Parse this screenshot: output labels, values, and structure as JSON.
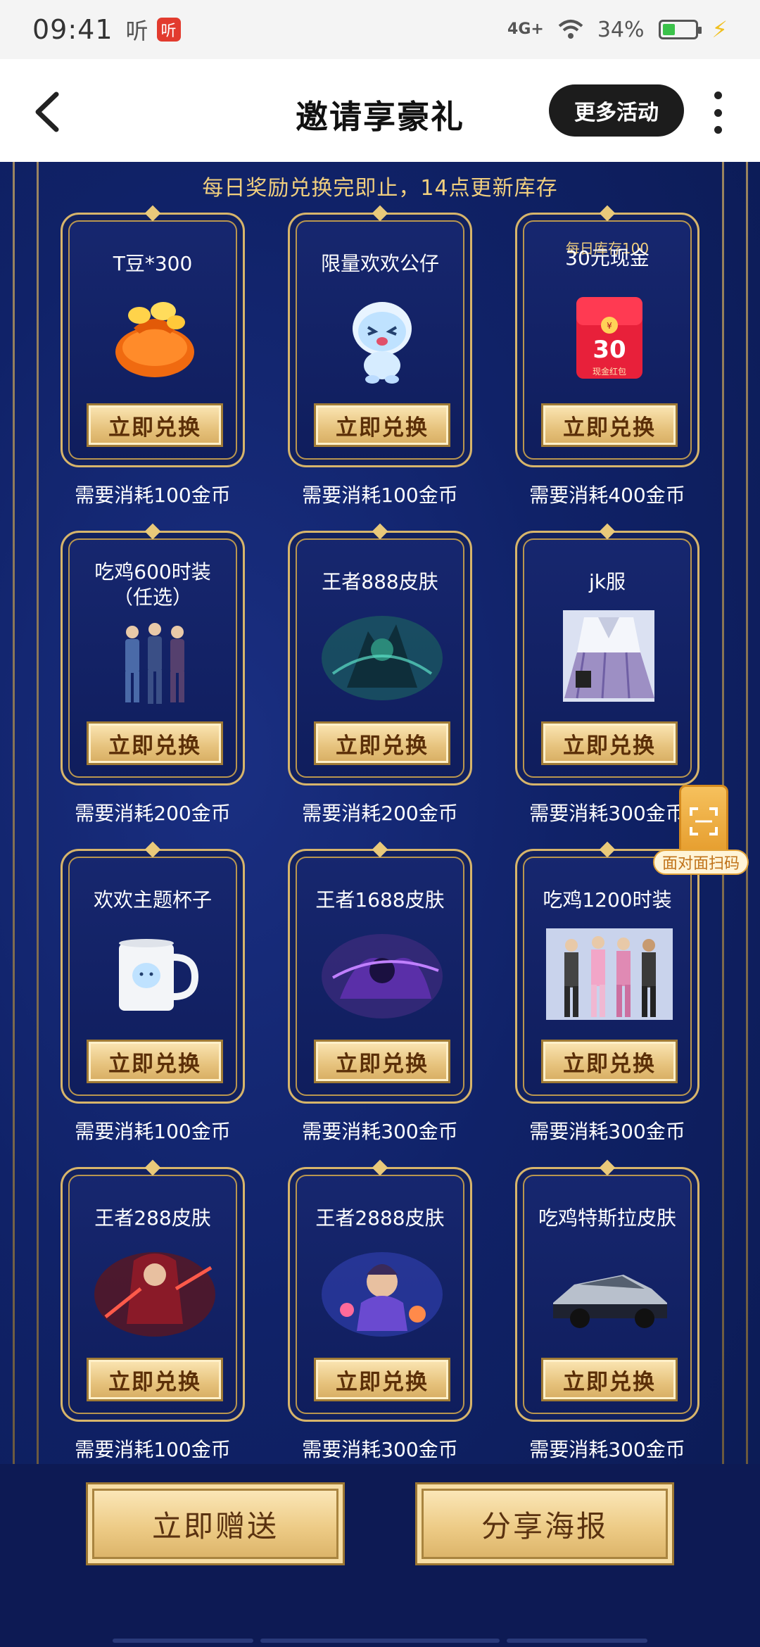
{
  "status_bar": {
    "time": "09:41",
    "ting_label": "听",
    "ting_badge": "听",
    "network": "4G+",
    "battery_percent": "34%",
    "battery_level": 0.34
  },
  "nav": {
    "title": "邀请享豪礼",
    "more_activities": "更多活动"
  },
  "notice": "每日奖励兑换完即止，14点更新库存",
  "redeem_label": "立即兑换",
  "rewards": [
    {
      "title": "T豆*300",
      "sub": "",
      "cost": "需要消耗100金币",
      "art": "coin-bag"
    },
    {
      "title": "限量欢欢公仔",
      "sub": "",
      "cost": "需要消耗100金币",
      "art": "mascot-doll"
    },
    {
      "title": "30元现金",
      "sub": "每日库存100",
      "cost": "需要消耗400金币",
      "art": "red-envelope"
    },
    {
      "title": "吃鸡600时装\n（任选）",
      "sub": "",
      "cost": "需要消耗200金币",
      "art": "outfit-trio"
    },
    {
      "title": "王者888皮肤",
      "sub": "",
      "cost": "需要消耗200金币",
      "art": "game-skin"
    },
    {
      "title": "jk服",
      "sub": "",
      "cost": "需要消耗300金币",
      "art": "jk-uniform"
    },
    {
      "title": "欢欢主题杯子",
      "sub": "",
      "cost": "需要消耗100金币",
      "art": "mug"
    },
    {
      "title": "王者1688皮肤",
      "sub": "",
      "cost": "需要消耗300金币",
      "art": "game-skin"
    },
    {
      "title": "吃鸡1200时装",
      "sub": "",
      "cost": "需要消耗300金币",
      "art": "outfit-group"
    },
    {
      "title": "王者288皮肤",
      "sub": "",
      "cost": "需要消耗100金币",
      "art": "game-skin"
    },
    {
      "title": "王者2888皮肤",
      "sub": "",
      "cost": "需要消耗300金币",
      "art": "game-skin"
    },
    {
      "title": "吃鸡特斯拉皮肤",
      "sub": "",
      "cost": "需要消耗300金币",
      "art": "car"
    }
  ],
  "envelope_value": "30",
  "envelope_caption": "现金红包",
  "scan_float_label": "面对面扫码",
  "bottom": {
    "gift_button": "立即赠送",
    "poster_button": "分享海报"
  },
  "colors": {
    "page_bg": "#0c1a57",
    "gold": "#d7b56b",
    "notice": "#f1cf7e"
  }
}
